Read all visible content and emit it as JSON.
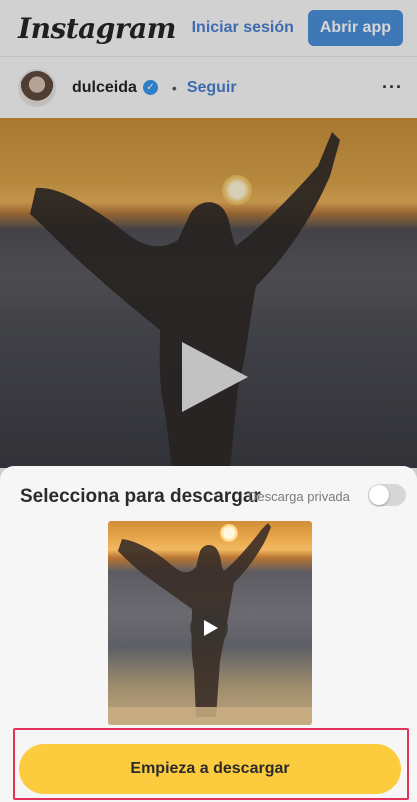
{
  "header": {
    "logo": "Instagram",
    "login_label": "Iniciar sesión",
    "open_app_label": "Abrir app"
  },
  "post": {
    "username": "dulceida",
    "verified_glyph": "✓",
    "separator": "•",
    "follow_label": "Seguir",
    "more_glyph": "···"
  },
  "download_sheet": {
    "title": "Selecciona para descargar",
    "private_label": "Descarga privada",
    "private_enabled": false,
    "start_label": "Empieza a descargar"
  },
  "colors": {
    "accent_blue": "#4a8fdb",
    "link_blue": "#4a7fd0",
    "cta_yellow": "#fdcc3e",
    "highlight_red": "#e0325b"
  }
}
